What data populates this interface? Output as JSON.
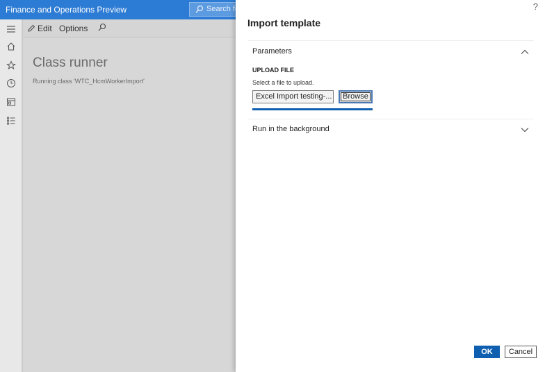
{
  "app": {
    "title": "Finance and Operations Preview"
  },
  "search": {
    "text": "Search fo"
  },
  "nav": {
    "items": [
      "hamburger-menu-icon",
      "home-icon",
      "star-icon",
      "clock-icon",
      "workspace-icon",
      "list-icon"
    ]
  },
  "actionpane": {
    "edit_label": "Edit",
    "options_label": "Options"
  },
  "page": {
    "heading": "Class runner",
    "subtitle": "Running class 'WTC_HcmWorkerImport'"
  },
  "dialog": {
    "help_label": "?",
    "title": "Import template",
    "parameters_title": "Parameters",
    "upload_label": "UPLOAD FILE",
    "upload_hint": "Select a file to upload.",
    "file_value": "Excel Import testing-...",
    "browse_label": "Browse",
    "upload_progress": 1.0,
    "background_title": "Run in the background",
    "ok_label": "OK",
    "cancel_label": "Cancel"
  },
  "colors": {
    "accent": "#0f5fb0",
    "header": "#2c7bd4"
  }
}
